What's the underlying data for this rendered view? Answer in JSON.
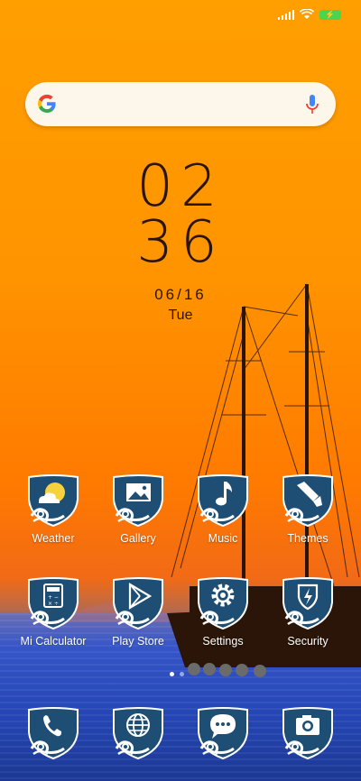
{
  "status_bar": {
    "battery_icon": "battery-charging-icon",
    "wifi_icon": "wifi-icon",
    "signal_icon": "cellular-signal-icon"
  },
  "search": {
    "logo_icon": "google-g-icon",
    "mic_icon": "microphone-icon"
  },
  "clock": {
    "hour": "02",
    "minute": "36",
    "date": "06/16",
    "day": "Tue"
  },
  "page_indicator": {
    "pages": 2,
    "current": 1
  },
  "apps_row1": [
    {
      "label": "Weather",
      "icon": "weather-icon"
    },
    {
      "label": "Gallery",
      "icon": "gallery-icon"
    },
    {
      "label": "Music",
      "icon": "music-note-icon"
    },
    {
      "label": "Themes",
      "icon": "paintbrush-icon"
    }
  ],
  "apps_row2": [
    {
      "label": "Mi Calculator",
      "icon": "calculator-icon"
    },
    {
      "label": "Play Store",
      "icon": "play-store-icon"
    },
    {
      "label": "Settings",
      "icon": "gear-icon"
    },
    {
      "label": "Security",
      "icon": "shield-bolt-icon"
    }
  ],
  "dock": [
    {
      "icon": "phone-icon"
    },
    {
      "icon": "browser-globe-icon"
    },
    {
      "icon": "messaging-icon"
    },
    {
      "icon": "camera-icon"
    }
  ],
  "colors": {
    "shield_fill": "#1e4e74",
    "shield_border": "#ffffff",
    "sky_top": "#ff9f00",
    "sea": "#2546b5",
    "clock_text": "#2a1406"
  }
}
